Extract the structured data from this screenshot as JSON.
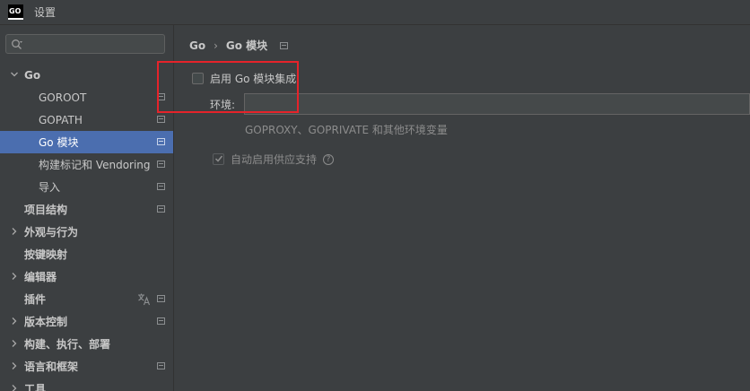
{
  "window": {
    "title": "设置",
    "logo_line1": "GO",
    "logo_line2": ""
  },
  "search": {
    "placeholder": "",
    "value": ""
  },
  "tree": [
    {
      "label": "Go",
      "level": 0,
      "expanded": true,
      "bold": true,
      "selected": false,
      "project_icon": false
    },
    {
      "label": "GOROOT",
      "level": 1,
      "selected": false,
      "project_icon": true
    },
    {
      "label": "GOPATH",
      "level": 1,
      "selected": false,
      "project_icon": true
    },
    {
      "label": "Go 模块",
      "level": 1,
      "selected": true,
      "project_icon": true
    },
    {
      "label": "构建标记和 Vendoring",
      "level": 1,
      "selected": false,
      "project_icon": true
    },
    {
      "label": "导入",
      "level": 1,
      "selected": false,
      "project_icon": true
    },
    {
      "label": "项目结构",
      "level": 0,
      "bold": true,
      "selected": false,
      "project_icon": true
    },
    {
      "label": "外观与行为",
      "level": 0,
      "collapsed": true,
      "bold": true,
      "selected": false,
      "project_icon": false
    },
    {
      "label": "按键映射",
      "level": 0,
      "bold": true,
      "selected": false,
      "project_icon": false
    },
    {
      "label": "编辑器",
      "level": 0,
      "collapsed": true,
      "bold": true,
      "selected": false,
      "project_icon": false
    },
    {
      "label": "插件",
      "level": 0,
      "bold": true,
      "selected": false,
      "project_icon": true,
      "translate_icon": true
    },
    {
      "label": "版本控制",
      "level": 0,
      "collapsed": true,
      "bold": true,
      "selected": false,
      "project_icon": true
    },
    {
      "label": "构建、执行、部署",
      "level": 0,
      "collapsed": true,
      "bold": true,
      "selected": false,
      "project_icon": false
    },
    {
      "label": "语言和框架",
      "level": 0,
      "collapsed": true,
      "bold": true,
      "selected": false,
      "project_icon": true
    },
    {
      "label": "工具",
      "level": 0,
      "collapsed": true,
      "bold": true,
      "selected": false,
      "project_icon": false
    }
  ],
  "content": {
    "breadcrumb": [
      "Go",
      "Go 模块"
    ],
    "enable_checkbox": {
      "label": "启用 Go 模块集成",
      "checked": false
    },
    "environment": {
      "label": "环境:",
      "value": "",
      "hint": "GOPROXY、GOPRIVATE 和其他环境变量"
    },
    "vendoring_checkbox": {
      "label": "自动启用供应支持",
      "checked": true,
      "disabled": true
    }
  },
  "colors": {
    "selection": "#4b6eaf",
    "highlight": "#e5232a",
    "background": "#3c3f41"
  }
}
